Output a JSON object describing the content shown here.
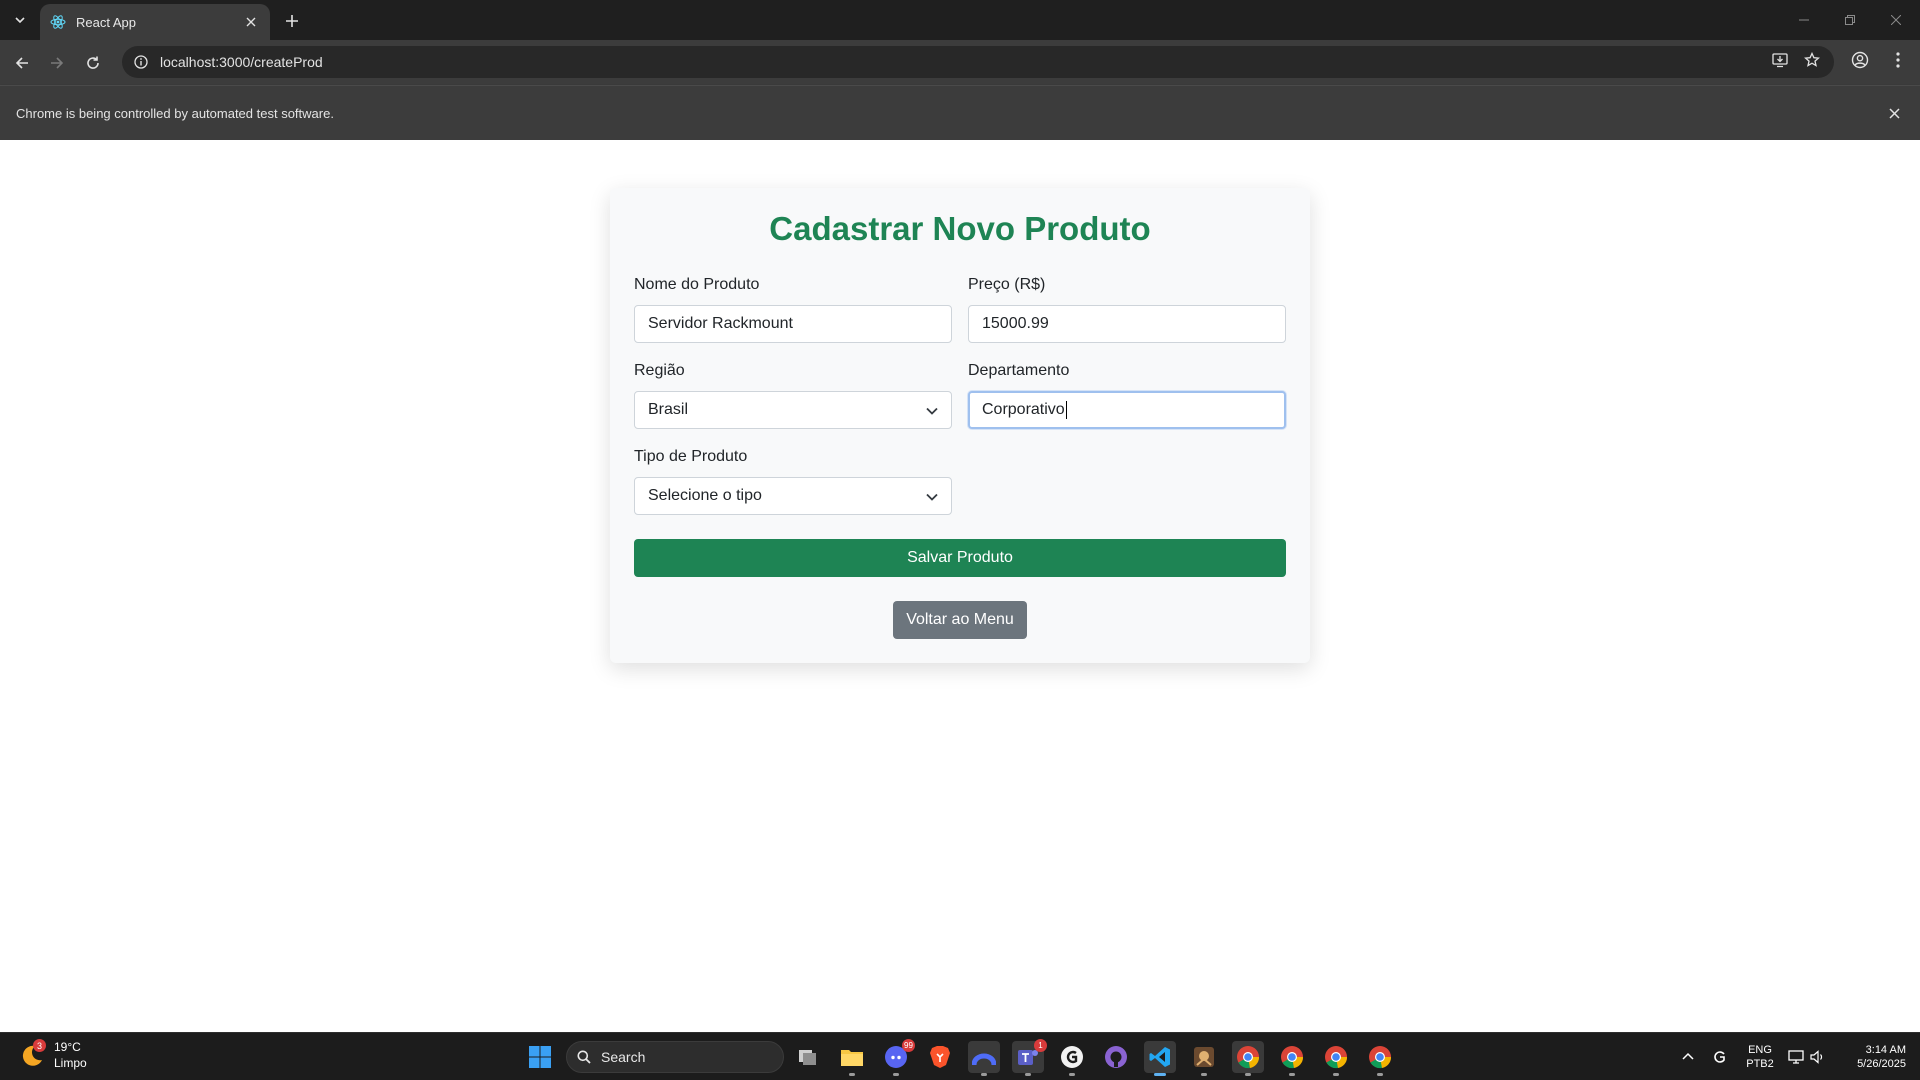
{
  "browser": {
    "tab_title": "React App",
    "url": "localhost:3000/createProd",
    "infobar_message": "Chrome is being controlled by automated test software."
  },
  "form": {
    "title": "Cadastrar Novo Produto",
    "fields": {
      "nome": {
        "label": "Nome do Produto",
        "value": "Servidor Rackmount"
      },
      "preco": {
        "label": "Preço (R$)",
        "value": "15000.99"
      },
      "regiao": {
        "label": "Região",
        "value": "Brasil"
      },
      "departamento": {
        "label": "Departamento",
        "value": "Corporativo"
      },
      "tipo": {
        "label": "Tipo de Produto",
        "value": "Selecione o tipo"
      }
    },
    "save_label": "Salvar Produto",
    "back_label": "Voltar ao Menu"
  },
  "taskbar": {
    "weather_temp": "19°C",
    "weather_desc": "Limpo",
    "weather_badge": "3",
    "search_label": "Search",
    "discord_badge": "99",
    "teams_badge": "1",
    "lang_primary": "ENG",
    "lang_secondary": "PTB2",
    "time": "3:14 AM",
    "date": "5/26/2025"
  },
  "colors": {
    "accent_green": "#1e8454",
    "secondary_gray": "#6c757d",
    "focus_border": "#9fc0ee"
  }
}
